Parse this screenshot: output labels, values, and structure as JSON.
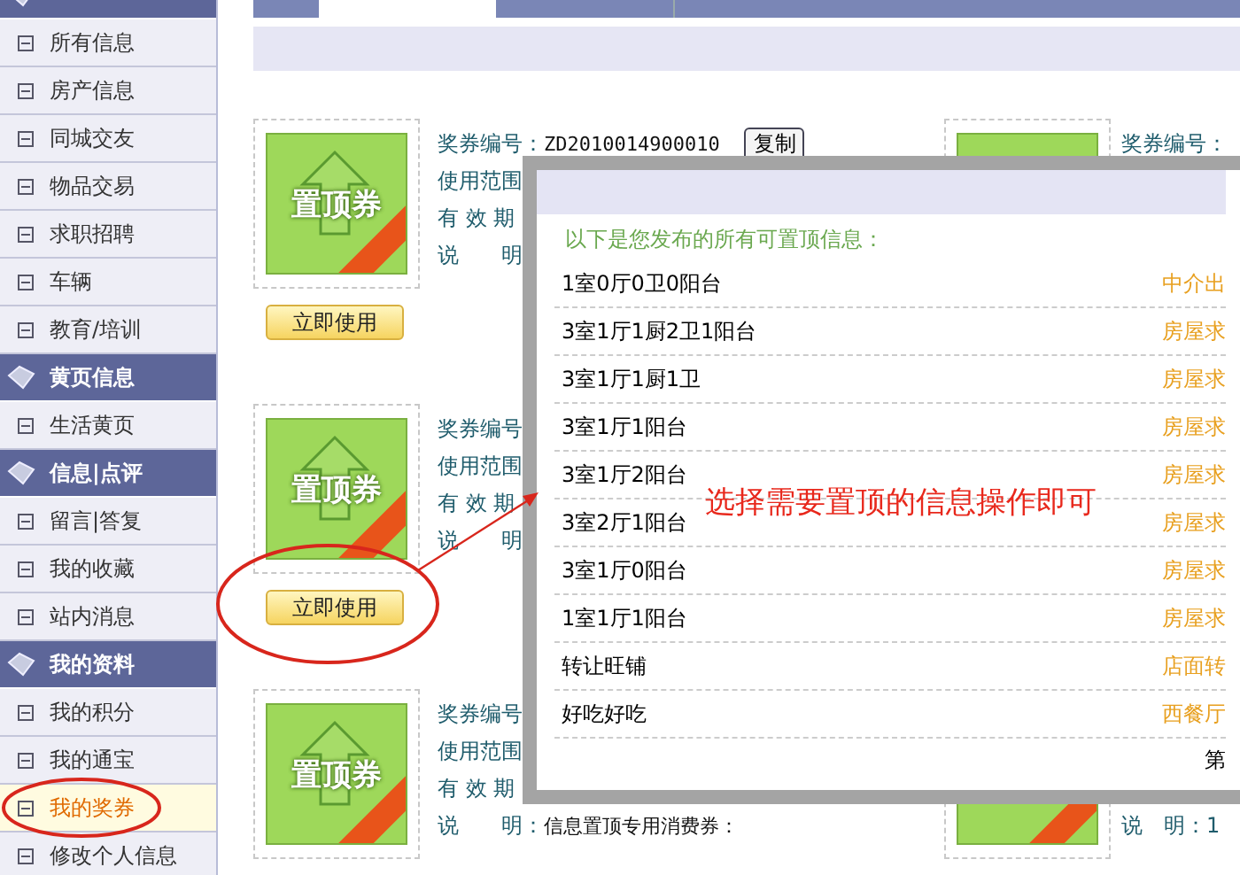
{
  "sidebar": {
    "sections": [
      {
        "items": [
          {
            "label": "所有信息",
            "selected": false
          },
          {
            "label": "房产信息",
            "selected": false
          },
          {
            "label": "同城交友",
            "selected": false
          },
          {
            "label": "物品交易",
            "selected": false
          },
          {
            "label": "求职招聘",
            "selected": false
          },
          {
            "label": "车辆",
            "selected": false
          },
          {
            "label": "教育/培训",
            "selected": false
          }
        ]
      },
      {
        "title": "黄页信息",
        "items": [
          {
            "label": "生活黄页",
            "selected": false
          }
        ]
      },
      {
        "title": "信息|点评",
        "items": [
          {
            "label": "留言|答复",
            "selected": false
          },
          {
            "label": "我的收藏",
            "selected": false
          },
          {
            "label": "站内消息",
            "selected": false
          }
        ]
      },
      {
        "title": "我的资料",
        "items": [
          {
            "label": "我的积分",
            "selected": false
          },
          {
            "label": "我的通宝",
            "selected": false
          },
          {
            "label": "我的奖券",
            "selected": true
          },
          {
            "label": "修改个人信息",
            "selected": false
          }
        ]
      }
    ]
  },
  "coupons_left": [
    {
      "image_text": "置顶券",
      "button": "立即使用",
      "fields": [
        {
          "kind": "code",
          "label": "奖券编号：",
          "value": "ZD2010014900010",
          "action": "复制"
        },
        {
          "kind": "scope",
          "label": "使用范围"
        },
        {
          "kind": "expiry",
          "label": "有 效 期"
        },
        {
          "kind": "note",
          "label": "说　　明"
        }
      ]
    },
    {
      "image_text": "置顶券",
      "button": "立即使用",
      "fields": [
        {
          "kind": "code",
          "label": "奖券编号"
        },
        {
          "kind": "scope",
          "label": "使用范围"
        },
        {
          "kind": "expiry",
          "label": "有 效 期"
        },
        {
          "kind": "note",
          "label": "说　　明"
        }
      ]
    },
    {
      "image_text": "置顶券",
      "fields": [
        {
          "kind": "code",
          "label": "奖券编号"
        },
        {
          "kind": "scope",
          "label": "使用范围"
        },
        {
          "kind": "expiry",
          "label": "有 效 期"
        },
        {
          "kind": "note",
          "label": "说　　明：",
          "value": "信息置顶专用消费券："
        }
      ]
    }
  ],
  "coupons_right": [
    {
      "fields": [
        {
          "kind": "code",
          "label": "奖券编号："
        }
      ]
    },
    {
      "fields": [
        {
          "kind": "note",
          "label": "说　明：1"
        }
      ]
    }
  ],
  "dialog": {
    "intro": "以下是您发布的所有可置顶信息：",
    "rows": [
      {
        "title": "1室0厅0卫0阳台",
        "category": "中介出"
      },
      {
        "title": "3室1厅1厨2卫1阳台",
        "category": "房屋求"
      },
      {
        "title": "3室1厅1厨1卫",
        "category": "房屋求"
      },
      {
        "title": "3室1厅1阳台",
        "category": "房屋求"
      },
      {
        "title": "3室1厅2阳台",
        "category": "房屋求"
      },
      {
        "title": "3室2厅1阳台",
        "category": "房屋求"
      },
      {
        "title": "3室1厅0阳台",
        "category": "房屋求"
      },
      {
        "title": "1室1厅1阳台",
        "category": "房屋求"
      },
      {
        "title": "转让旺铺",
        "category": "店面转"
      },
      {
        "title": "好吃好吃",
        "category": "西餐厅"
      }
    ],
    "pager": "第"
  },
  "annotation": {
    "text": "选择需要置顶的信息操作即可"
  }
}
